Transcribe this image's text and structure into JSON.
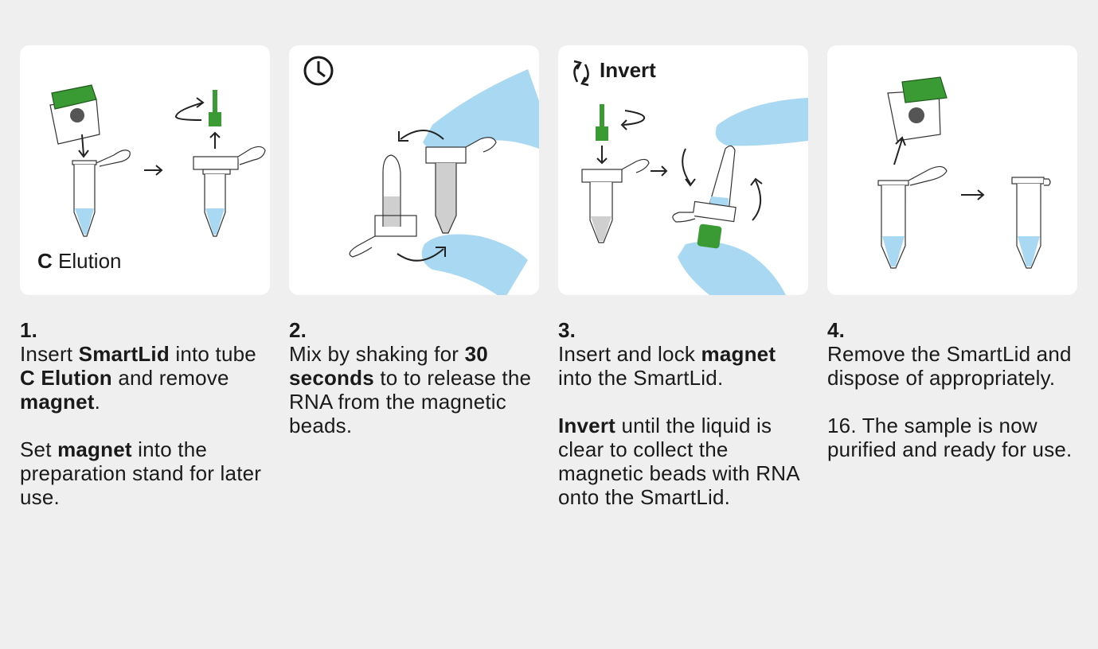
{
  "colors": {
    "background": "#efefef",
    "panel": "#ffffff",
    "liquid": "#a9d8f2",
    "glove": "#9fd5f3",
    "green": "#3a9a34"
  },
  "icons": {
    "step2": "clock-icon",
    "step3": "rotate-arrows-icon"
  },
  "panels": {
    "p1": {
      "label_bold": "C",
      "label_rest": " Elution"
    },
    "p3": {
      "label": "Invert"
    }
  },
  "steps": [
    {
      "number": "1.",
      "para1": {
        "t1": "Insert ",
        "b1": "SmartLid",
        "t2": " into tube ",
        "b2": "C Elution",
        "t3": " and remove ",
        "b3": "magnet",
        "t4": "."
      },
      "para2": {
        "t1": "Set ",
        "b1": "magnet",
        "t2": " into the preparation stand for later use."
      }
    },
    {
      "number": "2.",
      "para1": {
        "t1": "Mix by shaking for ",
        "b1": "30 seconds",
        "t2": " to to release the RNA from the magnetic beads."
      }
    },
    {
      "number": "3.",
      "para1": {
        "t1": "Insert and lock ",
        "b1": "magnet",
        "t2": " into the SmartLid."
      },
      "para2": {
        "b1": "Invert",
        "t1": " until the liquid is clear to collect the magnetic beads with RNA onto the SmartLid."
      }
    },
    {
      "number": "4.",
      "para1": "Remove the SmartLid and dispose of appropriately.",
      "para2": "16. The sample is now purified and ready for use."
    }
  ]
}
